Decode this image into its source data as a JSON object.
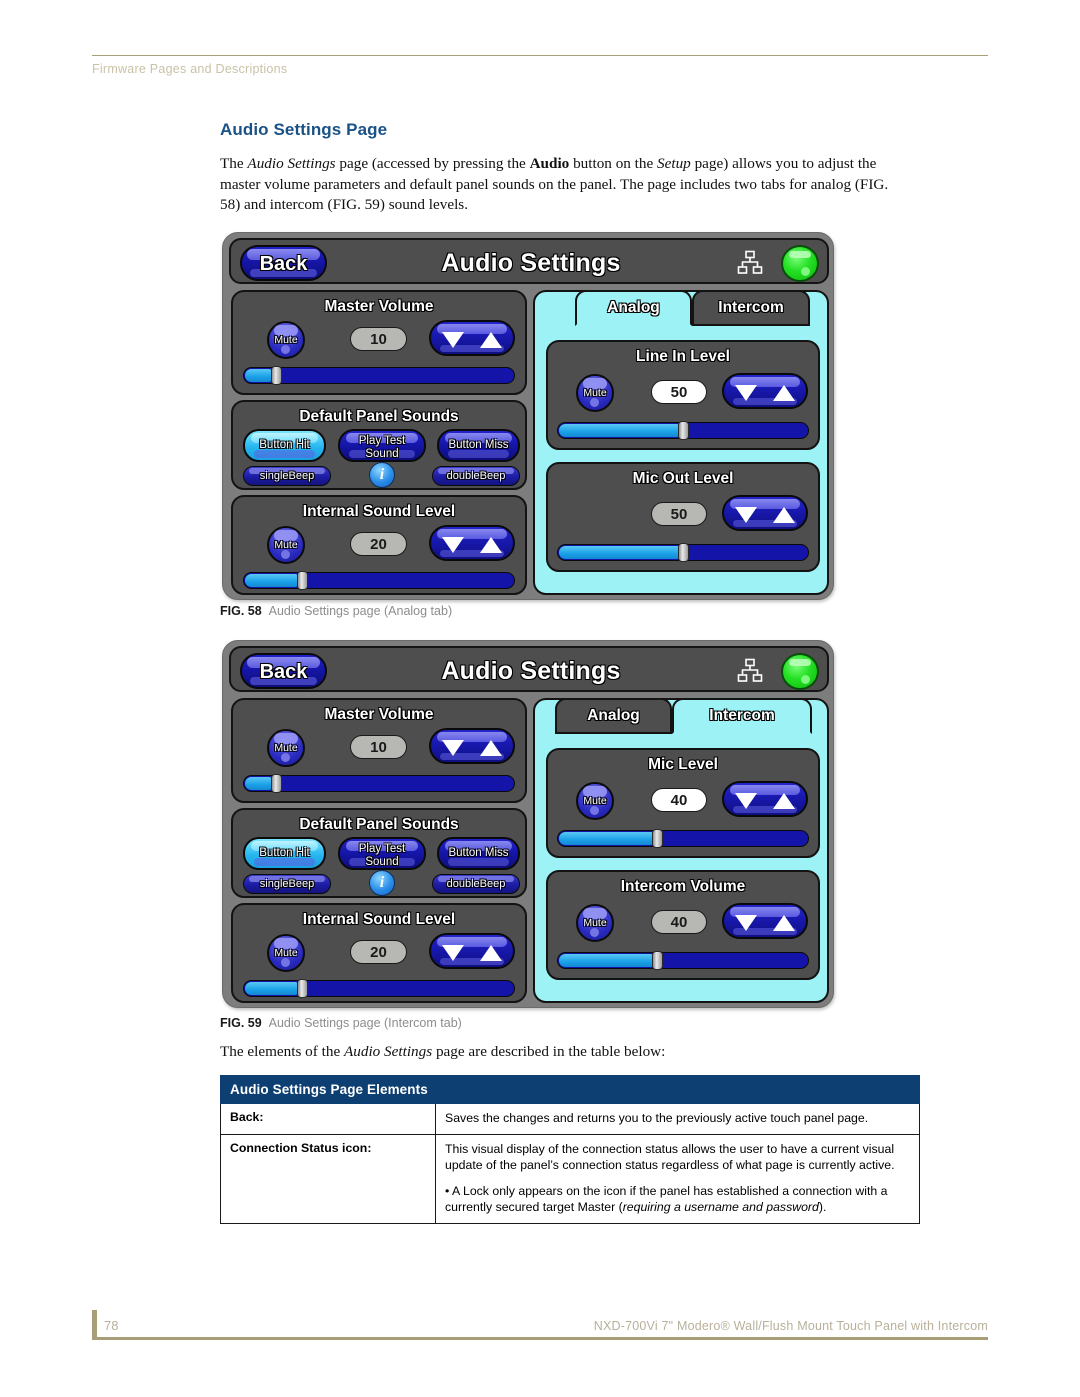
{
  "header": {
    "running_head": "Firmware Pages and Descriptions"
  },
  "page_title": "Audio Settings Page",
  "intro_paragraph": {
    "part1": "The ",
    "em1": "Audio Settings",
    "part2": " page (accessed by pressing the ",
    "strong1": "Audio",
    "part3": " button on the ",
    "em2": "Setup",
    "part4": " page) allows you to adjust the master volume parameters and default panel sounds on the panel.  The page includes two tabs for analog (FIG. 58) and intercom (FIG. 59) sound levels."
  },
  "figures": [
    {
      "id": "fig-58",
      "caption_label": "FIG. 58",
      "caption_text": "Audio Settings page (Analog tab)",
      "panel": {
        "back_label": "Back",
        "title": "Audio Settings",
        "net_icon": "network-icon",
        "status_icon": "connection-status-led",
        "master_volume": {
          "title": "Master Volume",
          "mute_label": "Mute",
          "value": "10",
          "slider_percent": 11
        },
        "default_panel_sounds": {
          "title": "Default Panel Sounds",
          "button_hit": "Button Hit",
          "play_test_sound_line1": "Play Test",
          "play_test_sound_line2": "Sound",
          "button_miss": "Button Miss",
          "single_beep": "singleBeep",
          "double_beep": "doubleBeep",
          "info_glyph": "i"
        },
        "internal_sound_level": {
          "title": "Internal Sound Level",
          "mute_label": "Mute",
          "value": "20",
          "slider_percent": 21
        },
        "tabs": [
          {
            "label": "Analog",
            "active": true
          },
          {
            "label": "Intercom",
            "active": false
          }
        ],
        "tab_groups": [
          {
            "title": "Line In Level",
            "mute_label": "Mute",
            "has_mute": true,
            "value": "50",
            "value_style": "white",
            "slider_percent": 49
          },
          {
            "title": "Mic Out Level",
            "mute_label": "",
            "has_mute": false,
            "value": "50",
            "value_style": "grey",
            "slider_percent": 49
          }
        ]
      }
    },
    {
      "id": "fig-59",
      "caption_label": "FIG. 59",
      "caption_text": "Audio Settings page (Intercom tab)",
      "panel": {
        "back_label": "Back",
        "title": "Audio Settings",
        "net_icon": "network-icon",
        "status_icon": "connection-status-led",
        "master_volume": {
          "title": "Master Volume",
          "mute_label": "Mute",
          "value": "10",
          "slider_percent": 11
        },
        "default_panel_sounds": {
          "title": "Default Panel Sounds",
          "button_hit": "Button Hit",
          "play_test_sound_line1": "Play Test",
          "play_test_sound_line2": "Sound",
          "button_miss": "Button Miss",
          "single_beep": "singleBeep",
          "double_beep": "doubleBeep",
          "info_glyph": "i"
        },
        "internal_sound_level": {
          "title": "Internal Sound Level",
          "mute_label": "Mute",
          "value": "20",
          "slider_percent": 21
        },
        "tabs": [
          {
            "label": "Analog",
            "active": false
          },
          {
            "label": "Intercom",
            "active": true
          }
        ],
        "tab_groups": [
          {
            "title": "Mic Level",
            "mute_label": "Mute",
            "has_mute": true,
            "value": "40",
            "value_style": "white",
            "slider_percent": 39
          },
          {
            "title": "Intercom Volume",
            "mute_label": "Mute",
            "has_mute": true,
            "value": "40",
            "value_style": "grey",
            "slider_percent": 39
          }
        ]
      }
    }
  ],
  "table_intro": {
    "part1": "The elements of the ",
    "em1": "Audio Settings",
    "part2": " page are described in the table below:"
  },
  "table": {
    "header": "Audio Settings Page Elements",
    "rows": [
      {
        "label": "Back:",
        "paragraphs": [
          "Saves the changes and returns you to the previously active touch panel page."
        ]
      },
      {
        "label": "Connection Status icon:",
        "paragraphs": [
          "This visual display of the connection status allows the user to have a current visual update of the panel’s connection status regardless of what page is currently active."
        ],
        "bullet_part1": "• A Lock only appears on the icon if the panel has established a connection with a currently secured target Master (",
        "bullet_em": "requiring a username and password",
        "bullet_part2": ")."
      }
    ]
  },
  "footer": {
    "page_number": "78",
    "doc_title": "NXD-700Vi 7\" Modero® Wall/Flush Mount Touch Panel with Intercom"
  },
  "colors": {
    "accent_blue": "#1a5288",
    "table_header_bg": "#0e3f72",
    "rule_tan": "#a89f78",
    "tab_active_bg": "#9cf2f5",
    "led_green": "#24e024"
  }
}
